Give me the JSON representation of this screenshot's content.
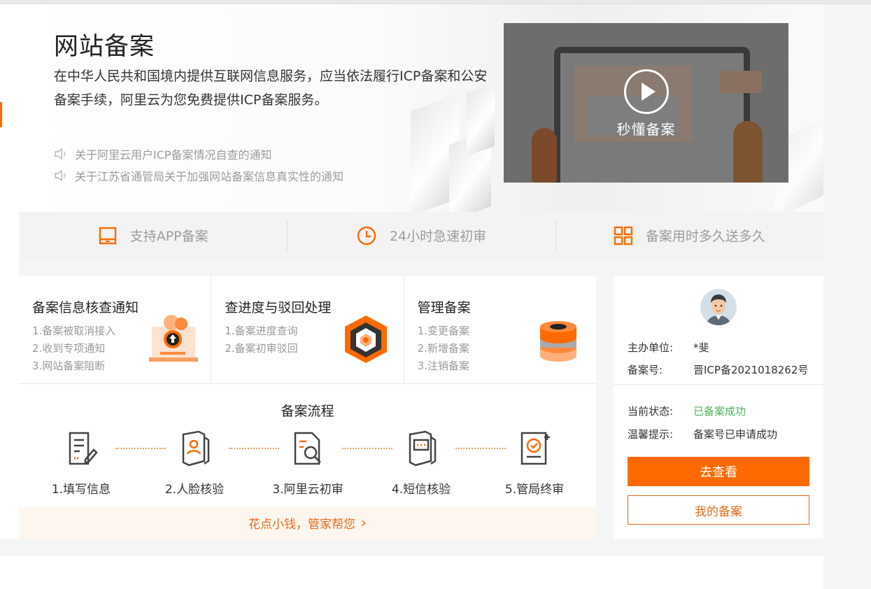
{
  "hero": {
    "title": "网站备案",
    "description": "在中华人民共和国境内提供互联网信息服务，应当依法履行ICP备案和公安备案手续，阿里云为您免费提供ICP备案服务。",
    "notices": [
      "关于阿里云用户ICP备案情况自查的通知",
      "关于江苏省通管局关于加强网站备案信息真实性的通知"
    ],
    "video_label": "秒懂备案"
  },
  "features": [
    {
      "label": "支持APP备案",
      "icon": "tablet-icon"
    },
    {
      "label": "24小时急速初审",
      "icon": "clock-icon"
    },
    {
      "label": "备案用时多久送多久",
      "icon": "grid-icon"
    }
  ],
  "cards": [
    {
      "title": "备案信息核查通知",
      "items": [
        "1.备案被取消接入",
        "2.收到专项通知",
        "3.网站备案阻断"
      ],
      "icon": "upload-illustration"
    },
    {
      "title": "查进度与驳回处理",
      "items": [
        "1.备案进度查询",
        "2.备案初审驳回"
      ],
      "icon": "cube-illustration"
    },
    {
      "title": "管理备案",
      "items": [
        "1.变更备案",
        "2.新增备案",
        "3.注销备案"
      ],
      "icon": "database-illustration"
    }
  ],
  "flow": {
    "title": "备案流程",
    "steps": [
      "1.填写信息",
      "2.人脸核验",
      "3.阿里云初审",
      "4.短信核验",
      "5.管局终审"
    ]
  },
  "promo": {
    "text": "花点小钱，管家帮您",
    "arrow": "›"
  },
  "account": {
    "sponsor_label": "主办单位:",
    "sponsor_value": "*斐",
    "record_label": "备案号:",
    "record_value": "晋ICP备2021018262号",
    "status_label": "当前状态:",
    "status_value": "已备案成功",
    "tip_label": "温馨提示:",
    "tip_value": "备案号已申请成功",
    "view_button": "去查看",
    "my_records_button": "我的备案"
  },
  "colors": {
    "accent": "#ff6a00",
    "success": "#4fb35a",
    "promo_bg": "#fdf6ef"
  }
}
